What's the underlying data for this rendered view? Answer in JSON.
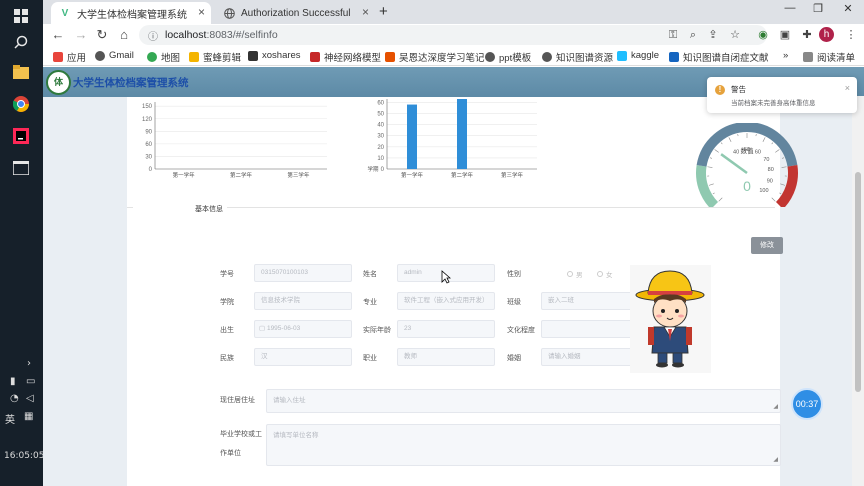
{
  "taskbar": {
    "ime_label": "英",
    "clock": "16:05:05"
  },
  "browser": {
    "tabs": [
      {
        "title": "大学生体检档案管理系统",
        "favicon": "V"
      },
      {
        "title": "Authorization Successful",
        "favicon": "globe"
      }
    ],
    "new_tab": "+",
    "url_host": "localhost",
    "url_path": ":8083/#/selfinfo",
    "profile_initial": "h",
    "bookmarks": [
      {
        "label": "应用",
        "color": "#e8453c"
      },
      {
        "label": "Gmail",
        "color": "#555"
      },
      {
        "label": "地图",
        "color": "#34a853"
      },
      {
        "label": "蜜蜂剪辑",
        "color": "#f4b400"
      },
      {
        "label": "xoshares",
        "color": "#333"
      },
      {
        "label": "神经网络模型",
        "color": "#c62828"
      },
      {
        "label": "吴恩达深度学习笔记",
        "color": "#e65100"
      },
      {
        "label": "ppt模板",
        "color": "#555"
      },
      {
        "label": "知识图谱资源",
        "color": "#555"
      },
      {
        "label": "kaggle",
        "color": "#20beff"
      },
      {
        "label": "知识图谱自闭症文献",
        "color": "#1565c0"
      }
    ],
    "more_bookmarks": "»",
    "reading_list": "阅读清单"
  },
  "app": {
    "logo_text": "体",
    "title": "大学生体检档案管理系统"
  },
  "charts": {
    "line_chart": {
      "type": "line",
      "categories": [
        "第一学年",
        "第二学年",
        "第三学年"
      ],
      "yticks": [
        0,
        30,
        60,
        90,
        120,
        150
      ],
      "ylim": [
        0,
        160
      ],
      "series": []
    },
    "bar_chart": {
      "type": "bar",
      "categories": [
        "第一学年",
        "第二学年",
        "第三学年"
      ],
      "values": [
        58,
        63,
        0
      ],
      "yticks": [
        0,
        10,
        20,
        30,
        40,
        50,
        60
      ],
      "ylim": [
        0,
        63
      ],
      "xlabel": "学期",
      "color": "#2f8ed8"
    },
    "gauge": {
      "type": "gauge",
      "title": "数值",
      "value": 0,
      "ticks": [
        40,
        50,
        60,
        70,
        80,
        90,
        100
      ]
    }
  },
  "section": {
    "title": "基本信息",
    "edit_button": "修改"
  },
  "form": {
    "student_id": {
      "label": "学号",
      "value": "0315070100103"
    },
    "name": {
      "label": "姓名",
      "value": "admin"
    },
    "gender": {
      "label": "性别",
      "options": [
        "男",
        "女"
      ]
    },
    "college": {
      "label": "学院",
      "value": "信息技术学院"
    },
    "major": {
      "label": "专业",
      "value": "软件工程（嵌入式应用开发）"
    },
    "class": {
      "label": "班级",
      "value": "嵌入二班"
    },
    "birth": {
      "label": "出生",
      "value": "1995-06-03"
    },
    "age": {
      "label": "实际年龄",
      "value": "23"
    },
    "education": {
      "label": "文化程度",
      "value": ""
    },
    "ethnicity": {
      "label": "民族",
      "value": "汉"
    },
    "occupation": {
      "label": "职业",
      "value": "教师"
    },
    "marriage": {
      "label": "婚姻",
      "value": "请输入婚姻"
    },
    "address": {
      "label": "现住居住址",
      "placeholder": "请输入住址"
    },
    "school": {
      "label1": "毕业学校或工",
      "label2": "作单位",
      "placeholder": "请填写单位名称"
    }
  },
  "toast": {
    "title": "警告",
    "message": "当前档案未完善身高体重信息",
    "close": "×"
  },
  "timer": "00:37"
}
